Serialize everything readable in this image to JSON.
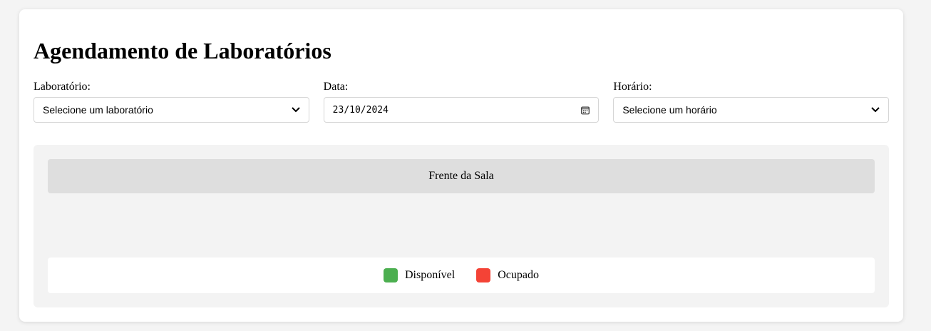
{
  "page": {
    "title": "Agendamento de Laboratórios"
  },
  "filters": {
    "laboratory": {
      "label": "Laboratório:",
      "selected": "Selecione um laboratório"
    },
    "date": {
      "label": "Data:",
      "value": "23/10/2024"
    },
    "time": {
      "label": "Horário:",
      "selected": "Selecione um horário"
    }
  },
  "room": {
    "front_label": "Frente da Sala"
  },
  "legend": {
    "items": [
      {
        "label": "Disponível",
        "color": "#4caf50"
      },
      {
        "label": "Ocupado",
        "color": "#f44336"
      }
    ]
  },
  "icons": {
    "select_arrow": "chevron-down-icon",
    "date_picker": "calendar-icon"
  }
}
